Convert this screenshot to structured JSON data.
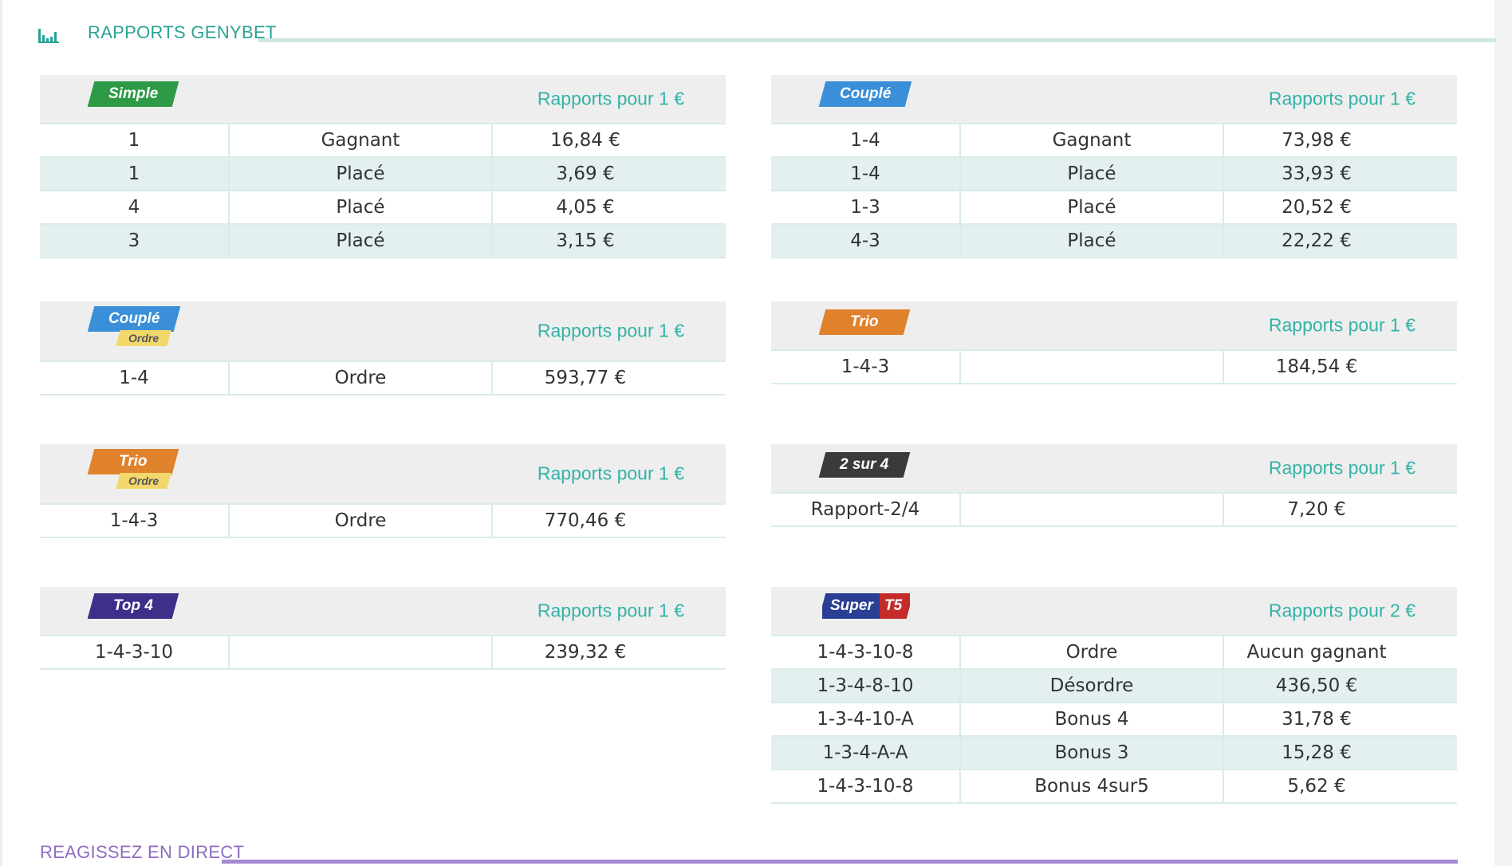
{
  "sections": {
    "rapports_title": "RAPPORTS GENYBET",
    "reagissez_title": "REAGISSEZ EN DIRECT"
  },
  "colors": {
    "teal": "#2aa394",
    "purple": "#8e6cc0",
    "simple": "#2e9a46",
    "couple": "#3a8fd8",
    "trio": "#e0812c",
    "deux_sur_quatre": "#3a3a3a",
    "top4": "#3d2f8a",
    "ordre_tag": "#f2d86b"
  },
  "tables": {
    "simple": {
      "badge": "Simple",
      "rapport": "Rapports pour 1 €",
      "rows": [
        [
          "1",
          "Gagnant",
          "16,84 €"
        ],
        [
          "1",
          "Placé",
          "3,69 €"
        ],
        [
          "4",
          "Placé",
          "4,05 €"
        ],
        [
          "3",
          "Placé",
          "3,15 €"
        ]
      ]
    },
    "couple": {
      "badge": "Couplé",
      "rapport": "Rapports pour 1 €",
      "rows": [
        [
          "1-4",
          "Gagnant",
          "73,98 €"
        ],
        [
          "1-4",
          "Placé",
          "33,93 €"
        ],
        [
          "1-3",
          "Placé",
          "20,52 €"
        ],
        [
          "4-3",
          "Placé",
          "22,22 €"
        ]
      ]
    },
    "couple_ordre": {
      "badge": "Couplé",
      "sub": "Ordre",
      "rapport": "Rapports pour 1 €",
      "rows": [
        [
          "1-4",
          "Ordre",
          "593,77 €"
        ]
      ]
    },
    "trio": {
      "badge": "Trio",
      "rapport": "Rapports pour 1 €",
      "rows": [
        [
          "1-4-3",
          "",
          "184,54 €"
        ]
      ]
    },
    "trio_ordre": {
      "badge": "Trio",
      "sub": "Ordre",
      "rapport": "Rapports pour 1 €",
      "rows": [
        [
          "1-4-3",
          "Ordre",
          "770,46 €"
        ]
      ]
    },
    "deux_sur_quatre": {
      "badge": "2 sur 4",
      "rapport": "Rapports pour 1 €",
      "rows": [
        [
          "Rapport-2/4",
          "",
          "7,20 €"
        ]
      ]
    },
    "top4": {
      "badge": "Top 4",
      "rapport": "Rapports pour 1 €",
      "rows": [
        [
          "1-4-3-10",
          "",
          "239,32 €"
        ]
      ]
    },
    "super_t5": {
      "badge_a": "Super",
      "badge_b": "T5",
      "rapport": "Rapports pour 2 €",
      "rows": [
        [
          "1-4-3-10-8",
          "Ordre",
          "Aucun gagnant"
        ],
        [
          "1-3-4-8-10",
          "Désordre",
          "436,50 €"
        ],
        [
          "1-3-4-10-A",
          "Bonus 4",
          "31,78 €"
        ],
        [
          "1-3-4-A-A",
          "Bonus 3",
          "15,28 €"
        ],
        [
          "1-4-3-10-8",
          "Bonus 4sur5",
          "5,62 €"
        ]
      ]
    }
  }
}
